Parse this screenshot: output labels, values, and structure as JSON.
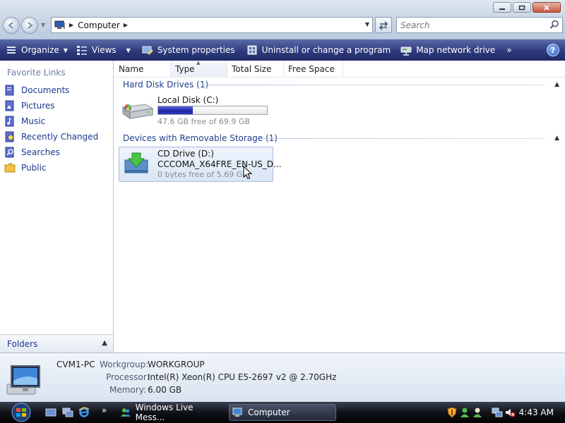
{
  "address": {
    "crumb": "Computer"
  },
  "search": {
    "placeholder": "Search"
  },
  "toolbar": {
    "organize": "Organize",
    "views": "Views",
    "system_properties": "System properties",
    "uninstall": "Uninstall or change a program",
    "map_drive": "Map network drive",
    "overflow": "»",
    "help": "?"
  },
  "nav": {
    "favorite_links": "Favorite Links",
    "items": [
      {
        "label": "Documents",
        "icon": "documents-icon"
      },
      {
        "label": "Pictures",
        "icon": "pictures-icon"
      },
      {
        "label": "Music",
        "icon": "music-icon"
      },
      {
        "label": "Recently Changed",
        "icon": "recently-changed-icon"
      },
      {
        "label": "Searches",
        "icon": "searches-icon"
      },
      {
        "label": "Public",
        "icon": "public-folder-icon"
      }
    ],
    "folders": "Folders"
  },
  "columns": [
    "Name",
    "Type",
    "Total Size",
    "Free Space"
  ],
  "groups": {
    "hdd": "Hard Disk Drives (1)",
    "removable": "Devices with Removable Storage (1)"
  },
  "drives": {
    "local": {
      "name": "Local Disk (C:)",
      "free_text": "47.6 GB free of 69.9 GB",
      "used_fraction": 0.32
    },
    "cd": {
      "name": "CD Drive (D:)",
      "label": "CCCOMA_X64FRE_EN-US_D...",
      "free_text": "0 bytes free of 5.69 GB"
    }
  },
  "details": {
    "pc_name": "CVM1-PC",
    "workgroup_key": "Workgroup:",
    "workgroup": "WORKGROUP",
    "processor_key": "Processor:",
    "processor": "Intel(R) Xeon(R) CPU E5-2697 v2 @ 2.70GHz",
    "memory_key": "Memory:",
    "memory": "6.00 GB"
  },
  "taskbar": {
    "tasks": [
      "Windows Live Mess...",
      "Computer"
    ],
    "clock": "4:43 AM",
    "overflow": "»"
  },
  "colors": {
    "command_bar": "#2f3a7c",
    "link_blue": "#1a3a8c",
    "group_blue": "#1e3f8a",
    "usage_fill": "#1f26a8"
  }
}
